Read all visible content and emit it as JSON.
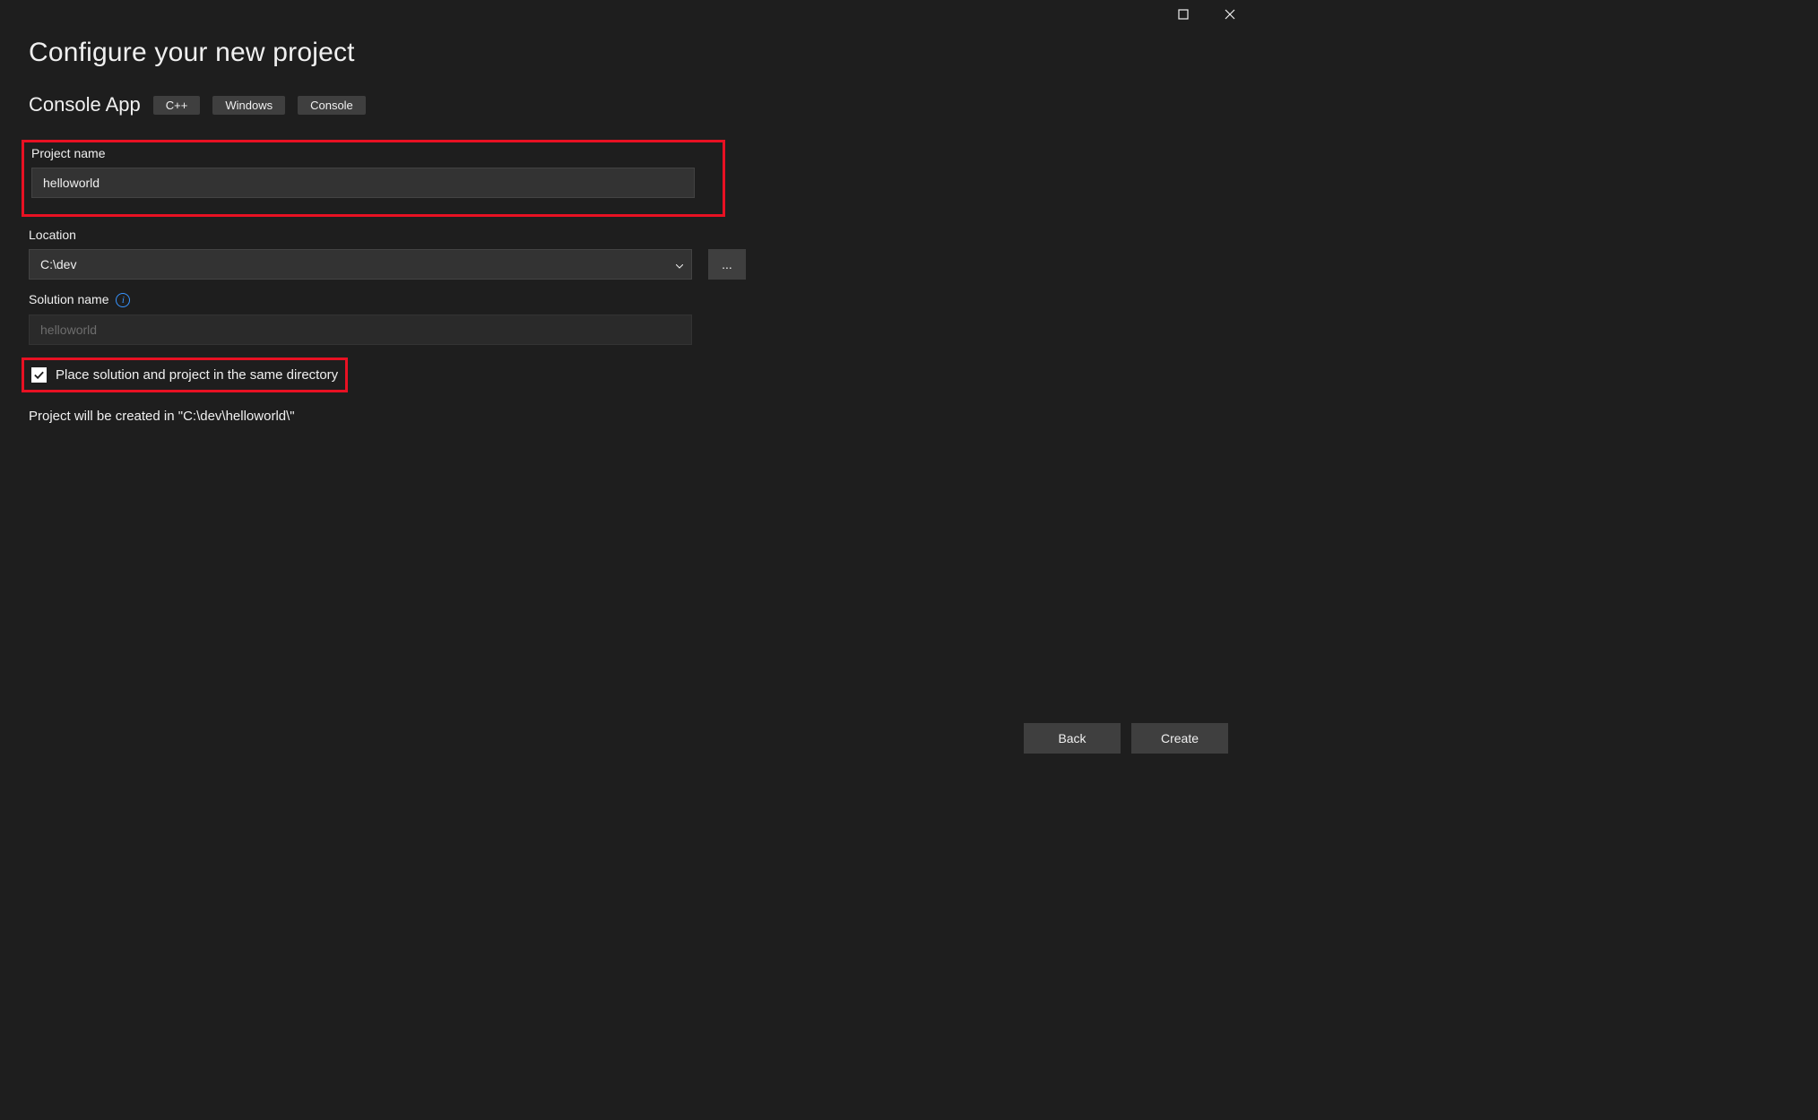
{
  "header": {
    "title": "Configure your new project"
  },
  "template": {
    "name": "Console App",
    "tags": [
      "C++",
      "Windows",
      "Console"
    ]
  },
  "fields": {
    "projectName": {
      "label": "Project name",
      "value": "helloworld"
    },
    "location": {
      "label": "Location",
      "value": "C:\\dev",
      "browseLabel": "..."
    },
    "solutionName": {
      "label": "Solution name",
      "placeholder": "helloworld"
    },
    "sameDirectory": {
      "checked": true,
      "label": "Place solution and project in the same directory"
    }
  },
  "creationPathText": "Project will be created in \"C:\\dev\\helloworld\\\"",
  "footer": {
    "back": "Back",
    "create": "Create"
  }
}
